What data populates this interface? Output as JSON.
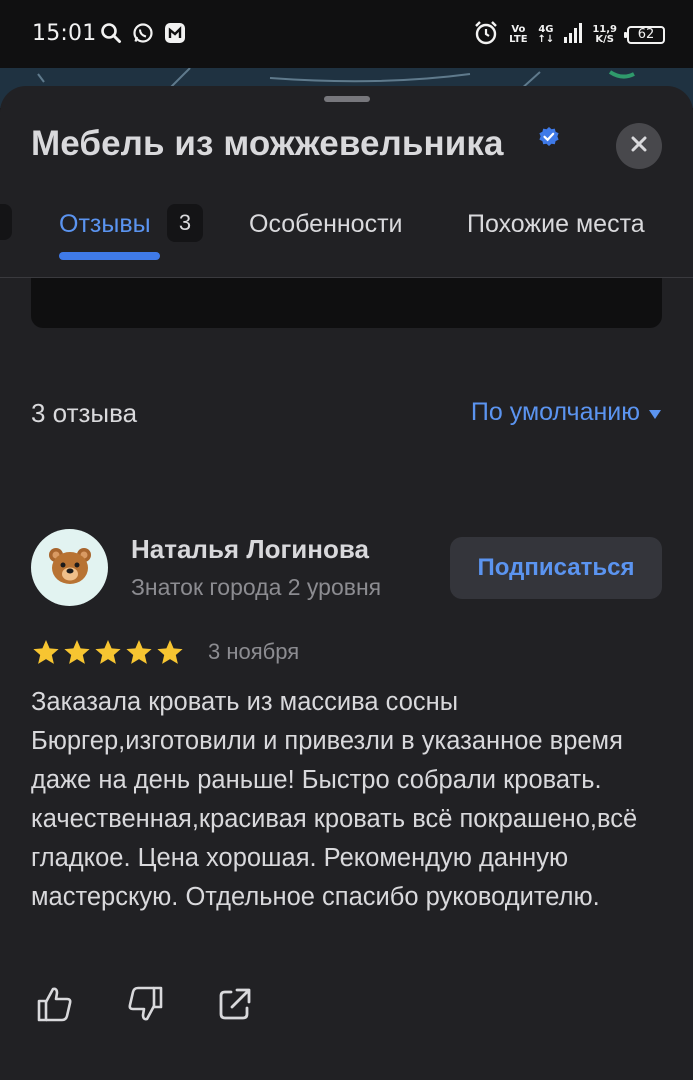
{
  "status_bar": {
    "time": "15:01",
    "network_top": "Vo",
    "network_bottom": "LTE",
    "signal_label": "4G",
    "speed_top": "11,9",
    "speed_bottom": "K/S",
    "battery": "62"
  },
  "place": {
    "title": "Мебель из можжевельника"
  },
  "tabs": {
    "reviews_label": "Отзывы",
    "reviews_count": "3",
    "features_label": "Особенности",
    "similar_label": "Похожие места"
  },
  "reviews": {
    "count_label": "3 отзыва",
    "sort_label": "По умолчанию",
    "items": [
      {
        "author": "Наталья Логинова",
        "level": "Знаток города 2 уровня",
        "subscribe_label": "Подписаться",
        "rating": 5,
        "date": "3 ноября",
        "text": "Заказала кровать из массива сосны Бюргер,изготовили и привезли в указанное время даже на день раньше! Быстро собрали кровать. качественная,красивая кровать всё покрашено,всё гладкое. Цена хорошая. Рекомендую данную мастерскую. Отдельное спасибо руководителю."
      }
    ]
  },
  "colors": {
    "accent": "#3f7ae8",
    "link": "#5b94f0",
    "star": "#f7c531",
    "background": "#212124"
  }
}
